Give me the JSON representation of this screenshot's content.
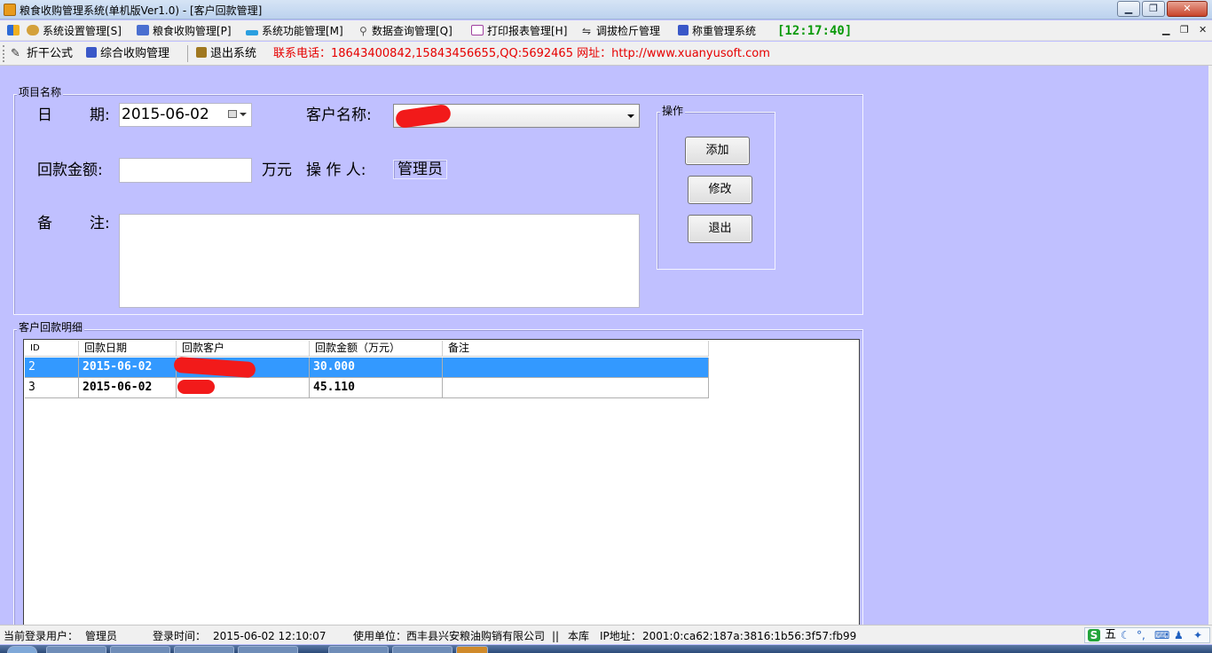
{
  "window": {
    "title": "粮食收购管理系统(单机版Ver1.0) - [客户回款管理]",
    "controls": [
      "minimize-icon",
      "restore-icon",
      "close-icon"
    ]
  },
  "menu": {
    "items": [
      {
        "label": "系统设置管理[S]",
        "icon": "users-icon"
      },
      {
        "label": "粮食收购管理[P]",
        "icon": "check-icon"
      },
      {
        "label": "系统功能管理[M]",
        "icon": "function-icon"
      },
      {
        "label": "数据查询管理[Q]",
        "icon": "search-icon"
      },
      {
        "label": "打印报表管理[H]",
        "icon": "report-icon"
      },
      {
        "label": "调拔检斤管理",
        "icon": "transfer-icon"
      },
      {
        "label": "称重管理系统",
        "icon": "scale-icon"
      }
    ],
    "clock": "[12:17:40]"
  },
  "toolbar": {
    "items": [
      {
        "label": "折干公式",
        "icon": "edit-icon"
      },
      {
        "label": "综合收购管理",
        "icon": "purchase-icon"
      },
      {
        "label": "退出系统",
        "icon": "exit-icon"
      }
    ],
    "contact": "联系电话：18643400842,15843456655,QQ:5692465 网址：http://www.xuanyusoft.com"
  },
  "form": {
    "group_title": "项目名称",
    "date_label_1": "日",
    "date_label_2": "期:",
    "date_value": "2015-06-02",
    "customer_label": "客户名称:",
    "amount_label": "回款金额:",
    "amount_value": "",
    "unit_label": "万元",
    "operator_label": "操 作 人:",
    "operator_value": "管理员",
    "remark_label_1": "备",
    "remark_label_2": "注:",
    "remark_value": ""
  },
  "actions": {
    "group_title": "操作",
    "add_label": "添加",
    "modify_label": "修改",
    "exit_label": "退出"
  },
  "details": {
    "group_title": "客户回款明细",
    "columns": [
      "ID",
      "回款日期",
      "回款客户",
      "回款金额（万元）",
      "备注"
    ],
    "rows": [
      {
        "id": "2",
        "date": "2015-06-02",
        "customer": "",
        "amount": "30.000",
        "remark": "",
        "selected": true
      },
      {
        "id": "3",
        "date": "2015-06-02",
        "customer": "",
        "amount": "45.110",
        "remark": "",
        "selected": false
      }
    ]
  },
  "status": {
    "user_label": "当前登录用户：",
    "user_value": "管理员",
    "login_label": "登录时间：",
    "login_value": "2015-06-02 12:10:07",
    "company_label": "使用单位：",
    "company_value": "西丰县兴安粮油购销有限公司",
    "separator": "||",
    "db": "本库",
    "ip_label": "IP地址：",
    "ip_value": "2001:0:ca62:187a:3816:1b56:3f57:fb99"
  },
  "ime": {
    "mode": "五"
  }
}
